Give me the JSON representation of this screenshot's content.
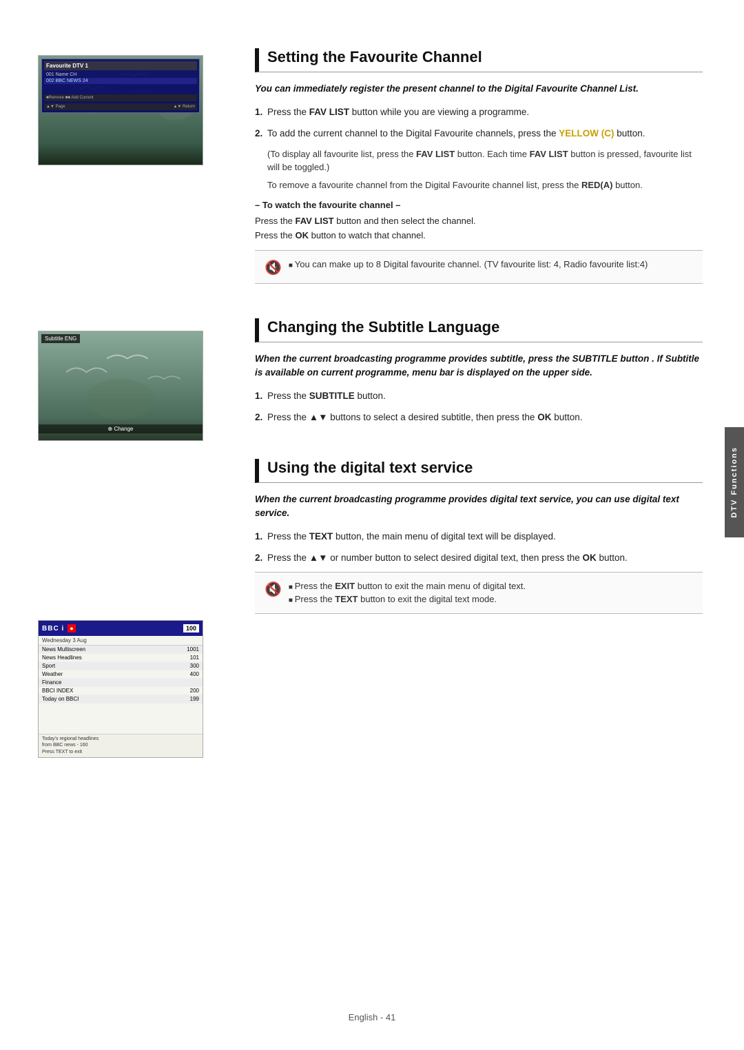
{
  "page": {
    "footer": "English - 41"
  },
  "side_tab": {
    "label": "DTV Functions"
  },
  "sections": {
    "favourite": {
      "title": "Setting the Favourite Channel",
      "intro": "You can immediately register the present channel to the Digital Favourite Channel List.",
      "steps": [
        {
          "num": "1.",
          "text": "Press the FAV LIST button while you are viewing a programme."
        },
        {
          "num": "2.",
          "text_before": "To add the current channel to the Digital Favourite channels, press the ",
          "yellow": "YELLOW (C)",
          "text_after": " button."
        }
      ],
      "sub_notes": [
        "(To display all favourite list, press the FAV LIST button. Each time FAV LIST button is pressed, favourite list will be toggled.)",
        "To remove a favourite channel from the Digital Favourite channel list, press the RED(A) button."
      ],
      "tip_title": "– To watch the favourite channel –",
      "tip_lines": [
        "Press the FAV LIST button and then select the channel.",
        "Press the OK button to watch that channel."
      ],
      "note": "You can make up to 8 Digital favourite channel. (TV favourite list: 4, Radio favourite list:4)",
      "screen": {
        "title": "Favourite DTV 1",
        "rows": [
          {
            "num": "001",
            "name": "Name CH",
            "active": false
          },
          {
            "num": "002",
            "name": "BBC NEWS 24",
            "active": true
          }
        ],
        "bottom_left": "■■Remove  ■■ Add Current",
        "bottom_right": "▲▼ Page    ▲▼ Return"
      }
    },
    "subtitle": {
      "title": "Changing the Subtitle Language",
      "intro": "When the current broadcasting programme provides subtitle, press the SUBTITLE button . If Subtitle is available on current programme, menu bar is displayed on the upper side.",
      "steps": [
        {
          "num": "1.",
          "text": "Press the SUBTITLE button."
        },
        {
          "num": "2.",
          "text": "Press the ▲▼ buttons to select a desired subtitle, then press the OK button."
        }
      ],
      "screen": {
        "label": "Subtitle  ENG",
        "bottom": "⊕ Change"
      }
    },
    "digital": {
      "title": "Using the digital text service",
      "intro": "When the current broadcasting programme provides digital text service, you can use digital text service.",
      "steps": [
        {
          "num": "1.",
          "text": "Press the TEXT button, the main menu of digital text will be displayed."
        },
        {
          "num": "2.",
          "text": "Press the ▲▼ or number button to select desired digital text, then press the OK button."
        }
      ],
      "notes": [
        "Press the EXIT button to exit the main menu of digital text.",
        "Press the TEXT button to exit the digital text mode."
      ],
      "screen": {
        "channel": "100",
        "date": "Wednesday 3 Aug",
        "rows": [
          {
            "label": "News Multiscreen",
            "num": "1001"
          },
          {
            "label": "News Headlines",
            "num": "101"
          },
          {
            "label": "Sport",
            "num": "300"
          },
          {
            "label": "Weather",
            "num": "400"
          },
          {
            "label": "Finance",
            "num": ""
          },
          {
            "label": "BBCI INDEX",
            "num": "200"
          },
          {
            "label": "Today on BBCI",
            "num": "199"
          }
        ],
        "footer_lines": [
          "Today's regional headlines",
          "from BBC news - 160",
          "Press TEXT to exit"
        ]
      }
    }
  }
}
